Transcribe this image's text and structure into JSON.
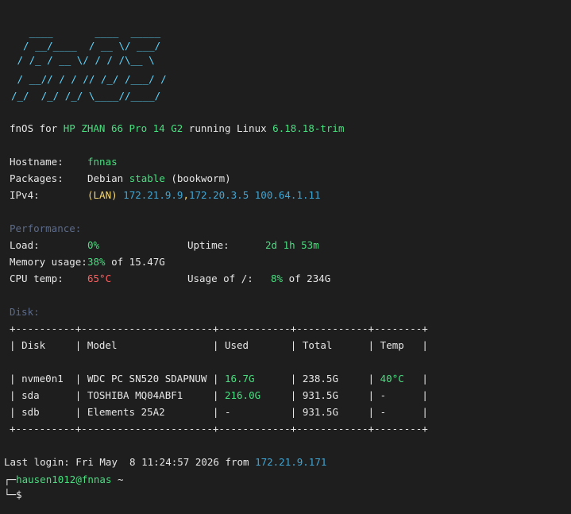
{
  "theme": {
    "bg": "#1e1e1e",
    "text": "#e6e6e6",
    "green": "#4ade80",
    "blue": "#3fa7d6",
    "yellow": "#f5d76e",
    "red": "#ff5f5f",
    "section": "#5c6b8a",
    "ascii": "#5fd7ff"
  },
  "logo": {
    "lines": [
      "   ____       ____  _____",
      "  / __/____  / __ \\/ ___/",
      " / /_ / __ \\/ / / /\\__ \\",
      " / __// / / // /_/ /___/ /",
      "/_/  /_/ /_/ \\____//____/"
    ]
  },
  "banner": {
    "os": "fnOS",
    "for_word": " for ",
    "model": "HP ZHAN 66 Pro 14 G2",
    "running_word": " running ",
    "kernel_name": "Linux",
    "kernel_version": "6.18.18-trim"
  },
  "info": {
    "hostname_label": "Hostname:",
    "hostname": "fnnas",
    "packages_label": "Packages:",
    "packages_prefix": "Debian",
    "packages_channel": "stable",
    "packages_suffix": "(bookworm)",
    "ipv4_label": "IPv4:",
    "ipv4_lan": "(LAN)",
    "ipv4_ip1": "172.21.9.9",
    "ipv4_sep": ",",
    "ipv4_ip2": "172.20.3.5",
    "ipv4_ip3": "100.64.1.11"
  },
  "performance": {
    "title": "Performance:",
    "load_label": "Load:",
    "load": "0%",
    "uptime_label": "Uptime:",
    "uptime": "2d 1h 53m",
    "mem_label": "Memory usage:",
    "mem_pct": "38%",
    "mem_of": " of 15.47G",
    "cpu_label": "CPU temp:",
    "cpu_temp": "65°C",
    "usage_label": "Usage of /:",
    "usage_pct": "8%",
    "usage_of": " of 234G"
  },
  "disk": {
    "title": "Disk:",
    "border": "+----------+----------------------+------------+------------+--------+",
    "headers": [
      "Disk",
      "Model",
      "Used",
      "Total",
      "Temp"
    ],
    "rows": [
      {
        "disk": "nvme0n1",
        "model": "WDC PC SN520 SDAPNUW",
        "used": "16.7G",
        "used_green": true,
        "total": "238.5G",
        "temp": "40°C",
        "temp_green": true
      },
      {
        "disk": "sda",
        "model": "TOSHIBA MQ04ABF1",
        "used": "216.0G",
        "used_green": true,
        "total": "931.5G",
        "temp": "-",
        "temp_green": false
      },
      {
        "disk": "sdb",
        "model": "Elements 25A2",
        "used": "-",
        "used_green": false,
        "total": "931.5G",
        "temp": "-",
        "temp_green": false
      }
    ]
  },
  "login": {
    "prefix": "Last login: Fri May  8 11:24:57 2026 from ",
    "ip": "172.21.9.171"
  },
  "prompt": {
    "corner_top": "┌─",
    "user_host": "hausen1012@fnnas",
    "path": " ~",
    "corner_bottom": "└─",
    "symbol": "$"
  }
}
